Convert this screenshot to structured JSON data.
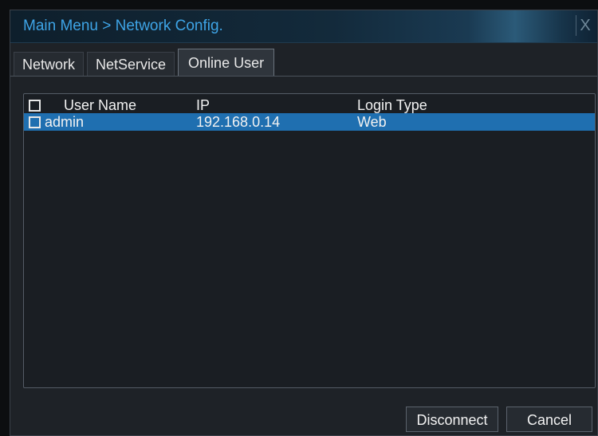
{
  "window": {
    "title": "Main Menu > Network Config.",
    "close_icon": "close-icon",
    "close_glyph": "X"
  },
  "tabs": [
    {
      "label": "Network",
      "active": false
    },
    {
      "label": "NetService",
      "active": false
    },
    {
      "label": "Online User",
      "active": true
    }
  ],
  "user_table": {
    "headers": {
      "user_name": "User Name",
      "ip": "IP",
      "login_type": "Login Type"
    },
    "rows": [
      {
        "user_name": "admin",
        "ip": "192.168.0.14",
        "login_type": "Web",
        "selected": true
      }
    ]
  },
  "buttons": {
    "disconnect": "Disconnect",
    "cancel": "Cancel"
  },
  "colors": {
    "title_text": "#3ea4e6",
    "selection": "#1f6fb0",
    "background": "#1e2227"
  }
}
